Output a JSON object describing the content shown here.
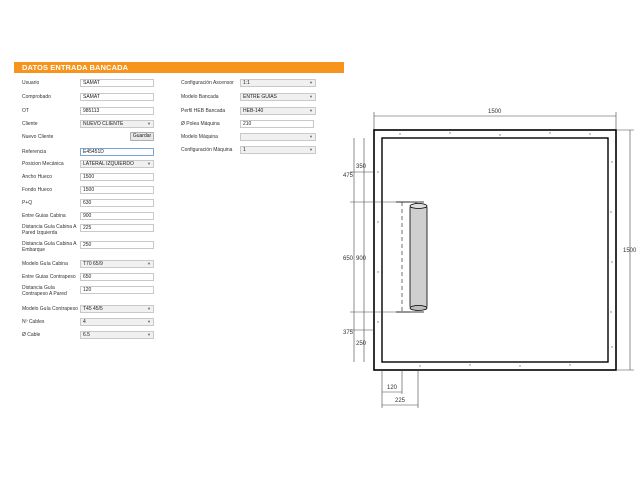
{
  "header": {
    "title": "DATOS ENTRADA BANCADA"
  },
  "form_left": [
    {
      "label": "Usuario",
      "value": "SAMAT",
      "kind": "input"
    },
    {
      "label": "Comprobado",
      "value": "SAMAT",
      "kind": "input"
    },
    {
      "label": "OT",
      "value": "985113",
      "kind": "input"
    },
    {
      "label": "Cliente",
      "value": "NUEVO CLIENTE",
      "kind": "select"
    },
    {
      "label": "Nuevo Cliente",
      "value": "",
      "kind": "input"
    },
    {
      "label": "Referencia",
      "value": "E45451D",
      "kind": "input"
    },
    {
      "label": "Posicion Mecánica",
      "value": "LATERAL IZQUIERDO",
      "kind": "select"
    },
    {
      "label": "Ancho Hueco",
      "value": "1500",
      "kind": "input"
    },
    {
      "label": "Fondo Hueco",
      "value": "1500",
      "kind": "input"
    },
    {
      "label": "P+Q",
      "value": "630",
      "kind": "input"
    },
    {
      "label": "Entre Guias Cabina",
      "value": "900",
      "kind": "input"
    },
    {
      "label": "Distancia Guía Cabina A Pared Izquierda",
      "value": "225",
      "kind": "input"
    },
    {
      "label": "Distancia Guía Cabina A Embarque",
      "value": "250",
      "kind": "input"
    },
    {
      "label": "Modelo Guía Cabina",
      "value": "T70 65/9",
      "kind": "select"
    },
    {
      "label": "Entre Guias Contrapeso",
      "value": "650",
      "kind": "input"
    },
    {
      "label": "Distancia Guía Contrapeso A Pared",
      "value": "120",
      "kind": "input"
    },
    {
      "label": "Modelo Guía Contrapeso",
      "value": "T45 45/5",
      "kind": "select"
    },
    {
      "label": "Nº Cables",
      "value": "4",
      "kind": "select"
    },
    {
      "label": "Ø Cable",
      "value": "6.5",
      "kind": "select"
    }
  ],
  "buttons": {
    "save": "Guardar"
  },
  "form_right": [
    {
      "label": "Configuración Ascensor",
      "value": "1:1",
      "kind": "select"
    },
    {
      "label": "Modelo Bancada",
      "value": "ENTRE GUIAS",
      "kind": "select"
    },
    {
      "label": "Perfil HEB Bancada",
      "value": "HEB-140",
      "kind": "select"
    },
    {
      "label": "Ø Polea Máquina",
      "value": "210",
      "kind": "input"
    },
    {
      "label": "Modelo Máquina",
      "value": "",
      "kind": "select"
    },
    {
      "label": "Configuración Máquina",
      "value": "1",
      "kind": "select"
    }
  ],
  "drawing": {
    "width_top": "1500",
    "depth_right": "1500",
    "d350": "350",
    "d475": "475",
    "d650": "650",
    "d900": "900",
    "d375": "375",
    "d250": "250",
    "d120": "120",
    "d225": "225"
  },
  "colors": {
    "accent": "#f7941d",
    "cylinder": "#cfcfcf"
  }
}
